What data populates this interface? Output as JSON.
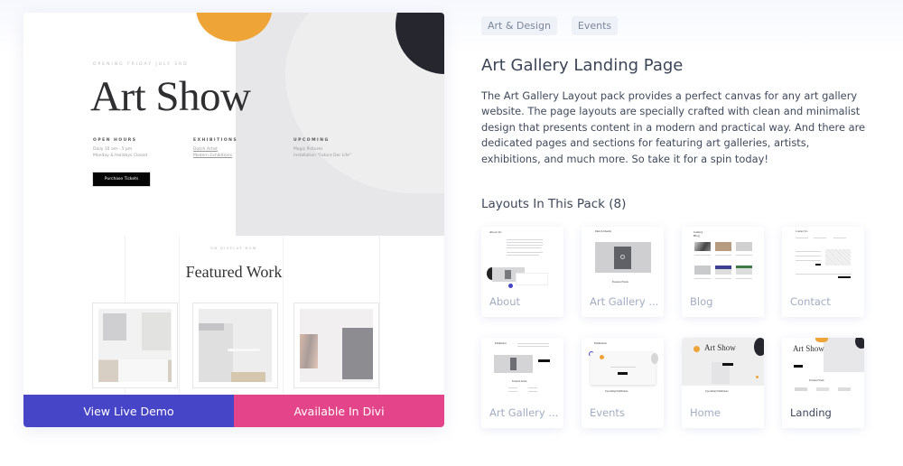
{
  "preview": {
    "hero": {
      "kicker": "OPENING FRIDAY JULY 3RD",
      "title": "Art Show",
      "columns": [
        {
          "heading": "OPEN HOURS",
          "lines": [
            "Daily 10 am - 5 pm",
            "Monday & Holidays Closed"
          ]
        },
        {
          "heading": "EXHIBITIONS",
          "lines": [
            "Dutch Artist",
            "Modern Exhibitions"
          ]
        },
        {
          "heading": "UPCOMING",
          "lines": [
            "Magic Pictures",
            "Installation \"Future Der Life\""
          ]
        }
      ],
      "button": "Purchase Tickets"
    },
    "featured": {
      "kicker": "ON DISPLAY NOW",
      "title": "Featured Work"
    },
    "actions": {
      "demo_label": "View Live Demo",
      "divi_label": "Available In Divi"
    }
  },
  "info": {
    "tags": [
      "Art & Design",
      "Events"
    ],
    "title": "Art Gallery Landing Page",
    "description": "The Art Gallery Layout pack provides a perfect canvas for any art gallery website. The page layouts are specially crafted with clean and minimalist design that presents content in a modern and practical way. And there are dedicated pages and sections for featuring art galleries, artists, exhibitions, and much more. So take it for a spin today!",
    "layouts_heading": "Layouts In This Pack (8)",
    "layouts": [
      {
        "label": "About",
        "thumb_title": "About Us"
      },
      {
        "label": "Art Gallery ...",
        "thumb_title": "Dutch Death",
        "thumb_caption": "Featured Work"
      },
      {
        "label": "Blog",
        "thumb_title": "Gallery Blog"
      },
      {
        "label": "Contact",
        "thumb_title": "Contact Us"
      },
      {
        "label": "Art Gallery ...",
        "thumb_title": "Exhibition",
        "thumb_caption": "Featured Artists"
      },
      {
        "label": "Events",
        "thumb_title": "Exhibitions",
        "thumb_caption": "Upcoming Exhibitions"
      },
      {
        "label": "Home",
        "thumb_title": "Art Show",
        "thumb_caption": "Upcoming Exhibitions"
      },
      {
        "label": "Landing",
        "thumb_title": "Art Show",
        "thumb_caption": "Featured Work",
        "active": true
      }
    ]
  },
  "colors": {
    "demo_button": "#4645c8",
    "divi_button": "#e4458a",
    "accent_orange": "#eea437",
    "accent_dark": "#25262e"
  }
}
